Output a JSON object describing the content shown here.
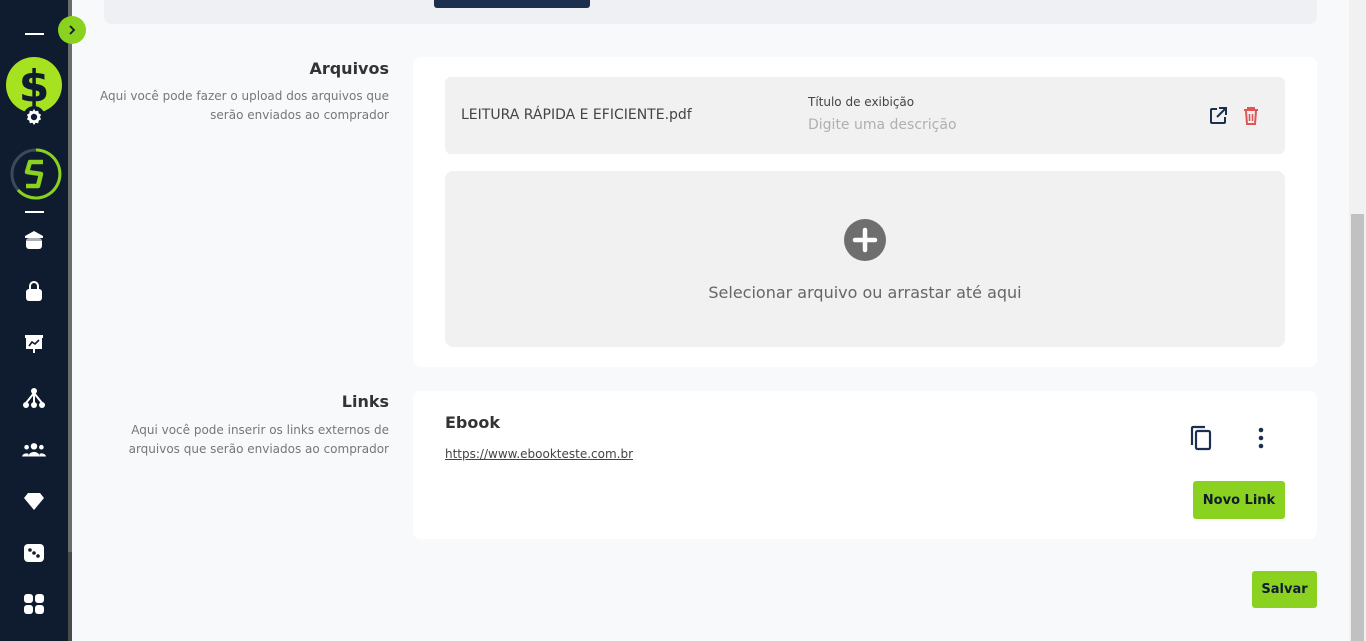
{
  "sidebar": {
    "toggle_icon": "chevron-right-icon",
    "logo_icon": "dollar-icon",
    "brand_icon": "brand-s-logo",
    "items": [
      {
        "icon": "home-icon"
      },
      {
        "icon": "shopping-bag-icon"
      },
      {
        "icon": "presentation-chart-icon"
      },
      {
        "icon": "network-icon"
      },
      {
        "icon": "users-group-icon"
      },
      {
        "icon": "diamond-icon"
      },
      {
        "icon": "dice-icon"
      },
      {
        "icon": "apps-grid-icon"
      }
    ]
  },
  "files": {
    "title": "Arquivos",
    "description": "Aqui você pode fazer o upload dos arquivos que serão enviados ao comprador",
    "file_name": "LEITURA RÁPIDA E EFICIENTE.pdf",
    "display_label": "Título de exibição",
    "display_placeholder": "Digite uma descrição",
    "dropzone_text": "Selecionar arquivo ou arrastar até aqui"
  },
  "links": {
    "title": "Links",
    "description": "Aqui você pode inserir os links externos de arquivos que serão enviados ao comprador",
    "item_title": "Ebook",
    "item_url": "https://www.ebookteste.com.br",
    "new_link_label": "Novo Link"
  },
  "save_label": "Salvar",
  "colors": {
    "sidebar_bg": "#0f1b2e",
    "accent_green": "#8ad21f",
    "delete_red": "#e05555"
  }
}
